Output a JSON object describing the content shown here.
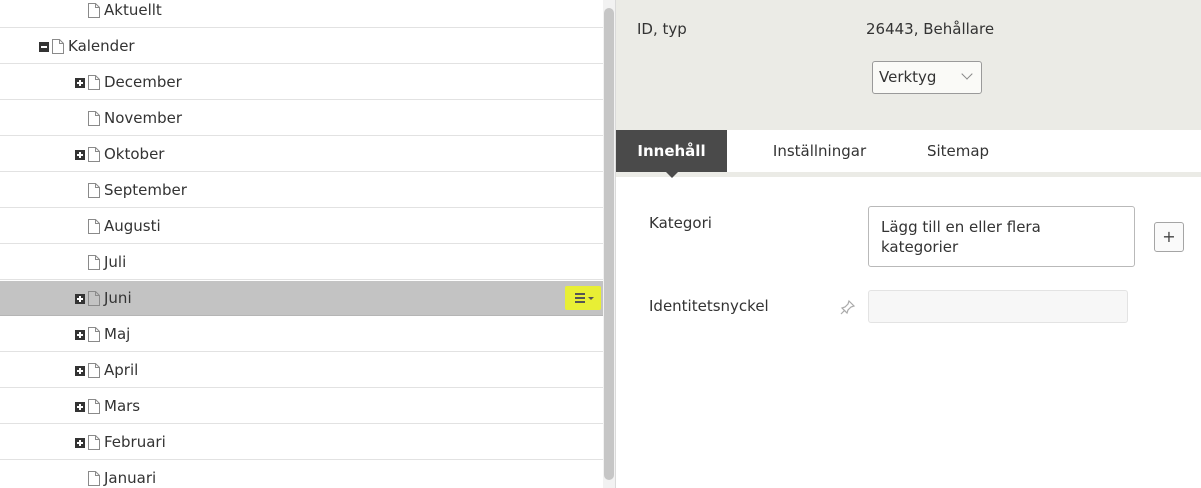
{
  "tree": {
    "items": [
      {
        "label": "Aktuellt",
        "level": 2,
        "toggle": "none"
      },
      {
        "label": "Kalender",
        "level": 1,
        "toggle": "minus"
      },
      {
        "label": "December",
        "level": 2,
        "toggle": "plus"
      },
      {
        "label": "November",
        "level": 2,
        "toggle": "none"
      },
      {
        "label": "Oktober",
        "level": 2,
        "toggle": "plus"
      },
      {
        "label": "September",
        "level": 2,
        "toggle": "none"
      },
      {
        "label": "Augusti",
        "level": 2,
        "toggle": "none"
      },
      {
        "label": "Juli",
        "level": 2,
        "toggle": "none"
      },
      {
        "label": "Juni",
        "level": 2,
        "toggle": "plus",
        "selected": true
      },
      {
        "label": "Maj",
        "level": 2,
        "toggle": "plus"
      },
      {
        "label": "April",
        "level": 2,
        "toggle": "plus"
      },
      {
        "label": "Mars",
        "level": 2,
        "toggle": "plus"
      },
      {
        "label": "Februari",
        "level": 2,
        "toggle": "plus"
      },
      {
        "label": "Januari",
        "level": 2,
        "toggle": "none"
      }
    ],
    "selected_menu_icon": "hamburger-menu-icon",
    "menu_highlight_color": "#e8ef35"
  },
  "header": {
    "id_label": "ID, typ",
    "id_value": "26443, Behållare",
    "tools_label": "Verktyg"
  },
  "tabs": [
    {
      "label": "Innehåll",
      "active": true
    },
    {
      "label": "Inställningar",
      "active": false
    },
    {
      "label": "Sitemap",
      "active": false
    }
  ],
  "form": {
    "category_label": "Kategori",
    "category_placeholder": "Lägg till en eller flera kategorier",
    "add_label": "+",
    "identity_label": "Identitetsnyckel",
    "identity_value": ""
  }
}
